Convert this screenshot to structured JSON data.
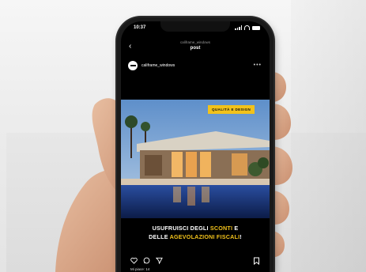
{
  "status_bar": {
    "time": "10:37"
  },
  "header": {
    "username": "califrame_windows",
    "title": "post"
  },
  "post": {
    "username": "califrame_windows",
    "tag": "QUALITÀ E DESIGN",
    "caption": {
      "line1_a": "USUFRUISCI DEGLI ",
      "line1_hl": "SCONTI",
      "line1_b": " E",
      "line2_a": "DELLE ",
      "line2_hl": "AGEVOLAZIONI FISCALI",
      "line2_b": "!"
    },
    "likes": "Mi piace: 14"
  },
  "colors": {
    "accent": "#f2c21b",
    "screen": "#000000",
    "pool": "#1f3f8a",
    "sky": "#7fa8d8"
  }
}
